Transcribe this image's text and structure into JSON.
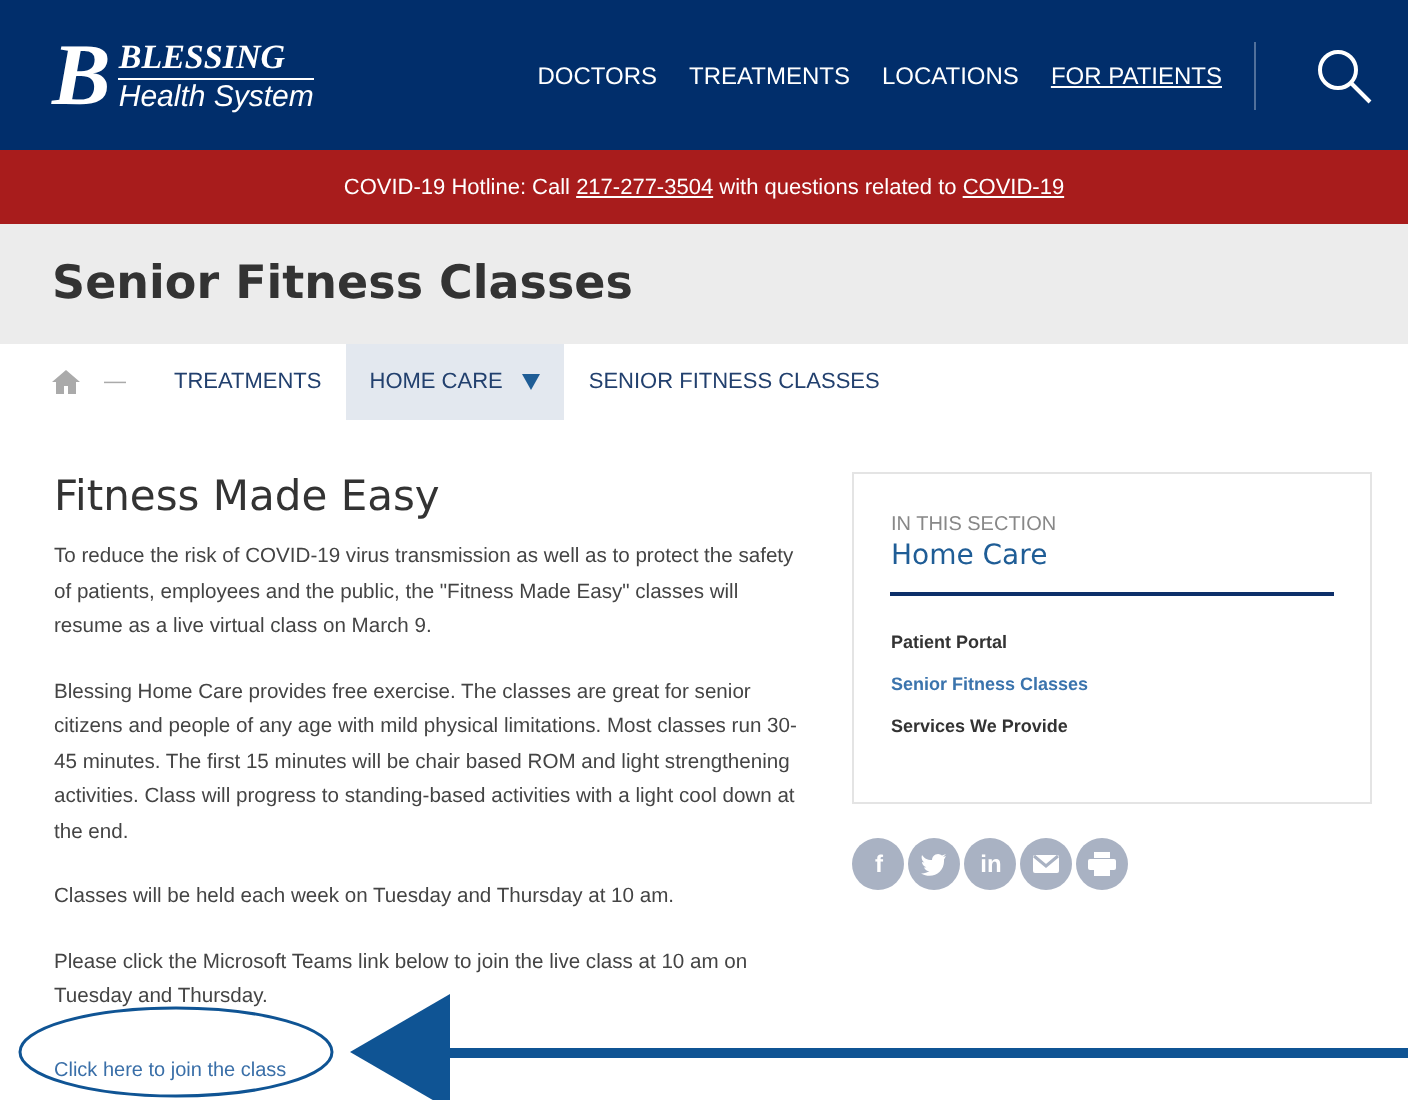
{
  "logo": {
    "mark": "B",
    "name": "BLESSING",
    "tagline": "Health System"
  },
  "nav": [
    {
      "label": "DOCTORS",
      "selected": false
    },
    {
      "label": "TREATMENTS",
      "selected": false
    },
    {
      "label": "LOCATIONS",
      "selected": false
    },
    {
      "label": "FOR PATIENTS",
      "selected": true
    }
  ],
  "alert": {
    "before": "COVID-19 Hotline: Call ",
    "phone": "217-277-3504",
    "middle": " with questions related to ",
    "link": "COVID-19"
  },
  "page_title": "Senior Fitness Classes",
  "breadcrumb": {
    "separator": "—",
    "items": [
      {
        "label": "TREATMENTS",
        "selected": false,
        "dropdown": false
      },
      {
        "label": "HOME CARE",
        "selected": true,
        "dropdown": true
      },
      {
        "label": "SENIOR FITNESS CLASSES",
        "selected": false,
        "dropdown": false
      }
    ]
  },
  "article": {
    "heading": "Fitness Made Easy",
    "paragraphs": [
      "To reduce the risk of COVID-19 virus transmission as well as to protect the safety of patients, employees and the public, the \"Fitness Made Easy\" classes will resume as a live virtual class on March 9.",
      "Blessing Home Care provides free exercise. The classes are great for senior citizens and people of any age with mild physical limitations. Most classes run 30-45 minutes. The first 15 minutes will be chair based ROM and light strengthening activities. Class will progress to standing-based activities with a light cool down at the end.",
      "Classes will be held each week on Tuesday and Thursday at 10 am.",
      "Please click the Microsoft Teams link below to join the live class at 10 am on Tuesday and Thursday."
    ],
    "link": "Click here to join the class"
  },
  "section": {
    "eyebrow": "IN THIS SECTION",
    "title": "Home Care",
    "items": [
      {
        "label": "Patient Portal",
        "selected": false
      },
      {
        "label": "Senior Fitness Classes",
        "selected": true
      },
      {
        "label": "Services We Provide",
        "selected": false
      }
    ]
  },
  "share": [
    {
      "kind": "letter",
      "label": "f"
    },
    {
      "kind": "bird"
    },
    {
      "kind": "letter",
      "label": "in"
    },
    {
      "kind": "mail"
    },
    {
      "kind": "print"
    }
  ]
}
